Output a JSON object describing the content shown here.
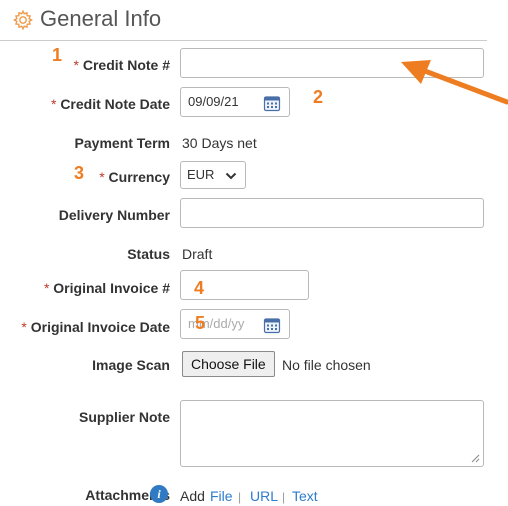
{
  "section": {
    "title": "General Info"
  },
  "fields": {
    "credit_note_no": {
      "required_mark": "*",
      "label": "Credit Note #",
      "value": ""
    },
    "credit_note_date": {
      "required_mark": "*",
      "label": "Credit Note Date",
      "value": "09/09/21"
    },
    "payment_term": {
      "label": "Payment Term",
      "value": "30 Days net"
    },
    "currency": {
      "required_mark": "*",
      "label": "Currency",
      "selected": "EUR"
    },
    "delivery_number": {
      "label": "Delivery Number",
      "value": ""
    },
    "status": {
      "label": "Status",
      "value": "Draft"
    },
    "original_invoice_no": {
      "required_mark": "*",
      "label": "Original Invoice #",
      "value": ""
    },
    "original_invoice_date": {
      "required_mark": "*",
      "label": "Original Invoice Date",
      "placeholder": "mm/dd/yy"
    },
    "image_scan": {
      "label": "Image Scan",
      "button_label": "Choose File",
      "status": "No file chosen"
    },
    "supplier_note": {
      "label": "Supplier Note",
      "value": ""
    },
    "attachments": {
      "label": "Attachments",
      "add_label": "Add",
      "link_file": "File",
      "sep1": "|",
      "link_url": "URL",
      "sep2": "|",
      "link_text": "Text"
    }
  },
  "annotations": {
    "n1": "1",
    "n2": "2",
    "n3": "3",
    "n4": "4",
    "n5": "5"
  },
  "colors": {
    "accent_orange": "#ee7d22",
    "required_red": "#c0392b",
    "link_blue": "#2e7bcf",
    "info_blue": "#2f7ac3"
  },
  "icons": {
    "header": "gear-icon",
    "date": "calendar-icon",
    "select": "chevron-down-icon",
    "info": "info-icon"
  }
}
